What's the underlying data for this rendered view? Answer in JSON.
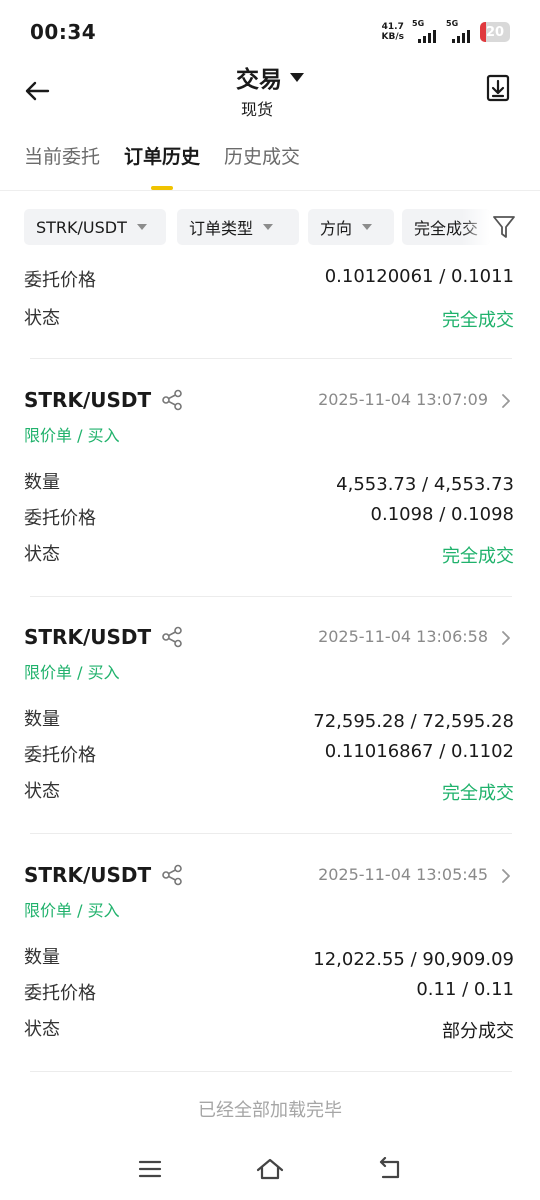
{
  "status_bar": {
    "time": "00:34",
    "net_speed_value": "41.7",
    "net_speed_unit": "KB/s",
    "signal_1_label": "5G",
    "signal_2_label": "5G",
    "battery_level": "20"
  },
  "header": {
    "title": "交易",
    "subtitle": "现货"
  },
  "tabs": [
    {
      "label": "当前委托",
      "active": false
    },
    {
      "label": "订单历史",
      "active": true
    },
    {
      "label": "历史成交",
      "active": false
    }
  ],
  "filters": [
    {
      "label": "STRK/USDT"
    },
    {
      "label": "订单类型"
    },
    {
      "label": "方向"
    },
    {
      "label": "完全成交"
    }
  ],
  "partial_order": {
    "rows": [
      {
        "label": "委托价格",
        "value": "0.10120061 / 0.1011"
      },
      {
        "label": "状态",
        "value": "完全成交"
      }
    ]
  },
  "orders": [
    {
      "pair": "STRK/USDT",
      "type": "限价单 / 买入",
      "time": "2025-11-04 13:07:09",
      "rows": [
        {
          "label": "数量",
          "value": "4,553.73 / 4,553.73"
        },
        {
          "label": "委托价格",
          "value": "0.1098 / 0.1098"
        },
        {
          "label": "状态",
          "value": "完全成交"
        }
      ]
    },
    {
      "pair": "STRK/USDT",
      "type": "限价单 / 买入",
      "time": "2025-11-04 13:06:58",
      "rows": [
        {
          "label": "数量",
          "value": "72,595.28 / 72,595.28"
        },
        {
          "label": "委托价格",
          "value": "0.11016867 / 0.1102"
        },
        {
          "label": "状态",
          "value": "完全成交"
        }
      ]
    },
    {
      "pair": "STRK/USDT",
      "type": "限价单 / 买入",
      "time": "2025-11-04 13:05:45",
      "rows": [
        {
          "label": "数量",
          "value": "12,022.55 / 90,909.09"
        },
        {
          "label": "委托价格",
          "value": "0.11 / 0.11"
        },
        {
          "label": "状态",
          "value": "部分成交"
        }
      ]
    }
  ],
  "footer_note": "已经全部加载完毕",
  "colors": {
    "accent_yellow": "#f0c300",
    "buy_green": "#20b26c",
    "battery_red": "#e0393e"
  },
  "icons": {
    "back": "arrow-left-icon",
    "download": "download-icon",
    "filter": "funnel-icon",
    "share": "share-icon",
    "chevron": "chevron-right-icon",
    "nav_menu": "menu-icon",
    "nav_home": "home-icon",
    "nav_back": "return-icon"
  }
}
